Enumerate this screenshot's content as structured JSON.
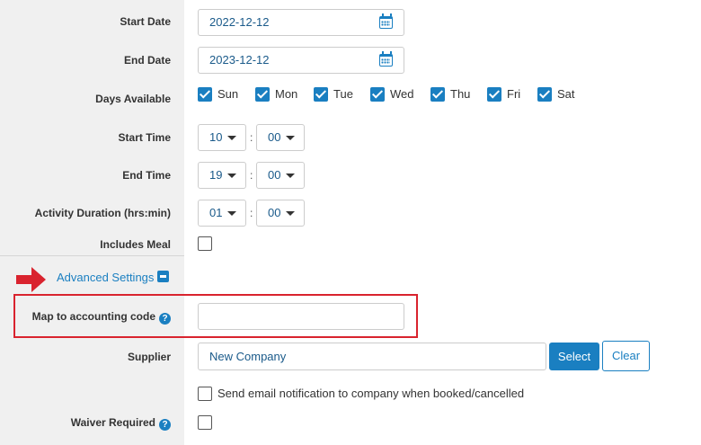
{
  "fields": {
    "start_date": {
      "label": "Start Date",
      "value": "2022-12-12",
      "icon": "calendar-icon"
    },
    "end_date": {
      "label": "End Date",
      "value": "2023-12-12",
      "icon": "calendar-icon"
    },
    "days_available": {
      "label": "Days Available",
      "days": [
        {
          "label": "Sun",
          "checked": true
        },
        {
          "label": "Mon",
          "checked": true
        },
        {
          "label": "Tue",
          "checked": true
        },
        {
          "label": "Wed",
          "checked": true
        },
        {
          "label": "Thu",
          "checked": true
        },
        {
          "label": "Fri",
          "checked": true
        },
        {
          "label": "Sat",
          "checked": true
        }
      ]
    },
    "start_time": {
      "label": "Start Time",
      "hours": "10",
      "minutes": "00",
      "separator": ":"
    },
    "end_time": {
      "label": "End Time",
      "hours": "19",
      "minutes": "00",
      "separator": ":"
    },
    "activity_duration": {
      "label": "Activity Duration (hrs:min)",
      "hours": "01",
      "minutes": "00",
      "separator": ":"
    },
    "includes_meal": {
      "label": "Includes Meal",
      "checked": false
    }
  },
  "advanced_settings": {
    "label": "Advanced Settings",
    "toggle_icon": "collapse-minus-icon",
    "map_to_accounting_code": {
      "label": "Map to accounting code",
      "help_icon": "question-circle-icon",
      "help_glyph": "?",
      "value": ""
    },
    "supplier": {
      "label": "Supplier",
      "value": "New Company",
      "select_label": "Select",
      "clear_label": "Clear"
    },
    "send_email": {
      "label": "Send email notification to company when booked/cancelled",
      "checked": false
    },
    "waiver_required": {
      "label": "Waiver Required",
      "help_icon": "question-circle-icon",
      "help_glyph": "?",
      "checked": false
    }
  },
  "annotations": {
    "arrow_color": "#d9232e",
    "highlight_color": "#d9232e"
  },
  "colors": {
    "accent": "#1a7fc1",
    "label_bg": "#f0f0f0"
  }
}
